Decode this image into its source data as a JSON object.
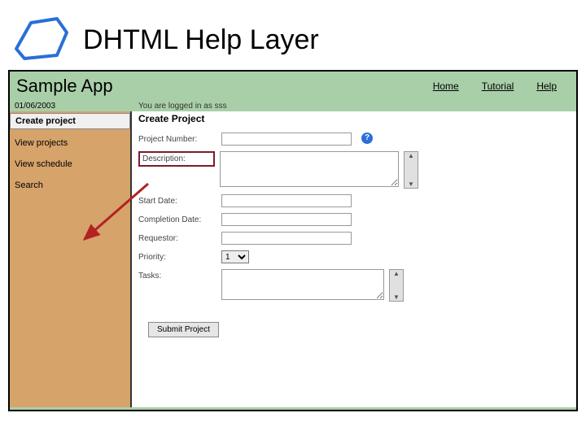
{
  "slide": {
    "title": "DHTML Help Layer"
  },
  "app": {
    "name": "Sample App",
    "topnav": {
      "home": "Home",
      "tutorial": "Tutorial",
      "help": "Help"
    },
    "info": {
      "date": "01/06/2003",
      "logged_in": "You are logged in as sss"
    }
  },
  "leftnav": {
    "create_project": "Create project",
    "view_projects": "View projects",
    "view_schedule": "View schedule",
    "search": "Search"
  },
  "form": {
    "heading": "Create Project",
    "labels": {
      "project_number": "Project Number:",
      "description": "Description:",
      "start_date": "Start Date:",
      "completion_date": "Completion Date:",
      "requestor": "Requestor:",
      "priority": "Priority:",
      "tasks": "Tasks:"
    },
    "priority_value": "1",
    "submit": "Submit Project"
  }
}
